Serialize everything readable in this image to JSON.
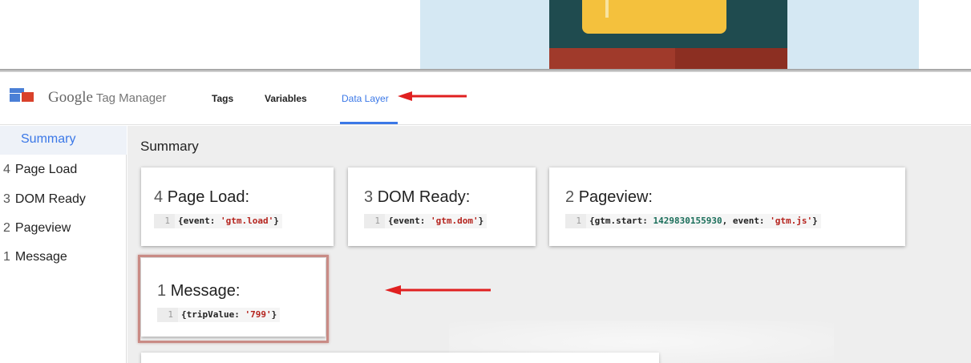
{
  "app": {
    "brand_google": "Google",
    "brand_product": " Tag Manager"
  },
  "nav": {
    "tabs": [
      {
        "label": "Tags"
      },
      {
        "label": "Variables"
      },
      {
        "label": "Data Layer",
        "active": true
      }
    ]
  },
  "sidebar": {
    "summary_label": "Summary",
    "items": [
      {
        "num": "4",
        "label": "Page Load"
      },
      {
        "num": "3",
        "label": "DOM Ready"
      },
      {
        "num": "2",
        "label": "Pageview"
      },
      {
        "num": "1",
        "label": "Message"
      }
    ]
  },
  "main": {
    "title": "Summary",
    "cards": [
      {
        "num": "4",
        "title": "Page Load:",
        "line_no": "1",
        "code_pre": "{event: ",
        "code_str": "'gtm.load'",
        "code_post": "}"
      },
      {
        "num": "3",
        "title": "DOM Ready:",
        "line_no": "1",
        "code_pre": "{event: ",
        "code_str": "'gtm.dom'",
        "code_post": "}"
      },
      {
        "num": "2",
        "title": "Pageview:",
        "line_no": "1",
        "code_pre": "{gtm.start: ",
        "code_num": "1429830155930",
        "code_mid": ", event: ",
        "code_str": "'gtm.js'",
        "code_post": "}"
      },
      {
        "num": "1",
        "title": "Message:",
        "line_no": "1",
        "code_pre": "{tripValue: ",
        "code_str": "'799'",
        "code_post": "}"
      }
    ]
  },
  "colors": {
    "accent": "#3b78e7",
    "arrow": "#e02020",
    "highlight_border": "#c98b85",
    "code_string": "#b5231d",
    "code_number": "#1a6e5a"
  }
}
